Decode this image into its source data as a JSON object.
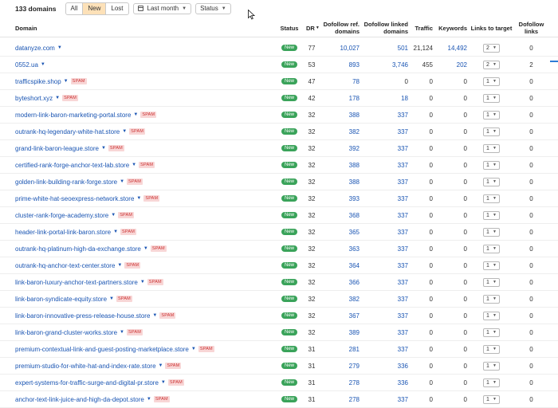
{
  "toolbar": {
    "domain_count": "133 domains",
    "filters": [
      "All",
      "New",
      "Lost"
    ],
    "active_filter": "New",
    "date_range": "Last month",
    "status": "Status"
  },
  "columns": {
    "domain": "Domain",
    "status": "Status",
    "dr": "DR",
    "dofollow_ref_domains": "Dofollow ref. domains",
    "dofollow_linked_domains": "Dofollow linked domains",
    "traffic": "Traffic",
    "keywords": "Keywords",
    "links_to_target": "Links to target",
    "dofollow_links": "Dofollow links"
  },
  "labels": {
    "status_badge": "New",
    "spam": "SPAM"
  },
  "rows": [
    {
      "domain": "datanyze.com",
      "spam": false,
      "dr": "77",
      "ref": "10,027",
      "linked": "501",
      "traffic": "21,124",
      "keywords": "14,492",
      "kw_link": true,
      "links": "2",
      "dofollow": "0"
    },
    {
      "domain": "0552.ua",
      "spam": false,
      "dr": "53",
      "ref": "893",
      "linked": "3,746",
      "traffic": "455",
      "keywords": "202",
      "kw_link": true,
      "links": "2",
      "dofollow": "2"
    },
    {
      "domain": "trafficspike.shop",
      "spam": true,
      "dr": "47",
      "ref": "78",
      "linked": "0",
      "traffic": "0",
      "keywords": "0",
      "kw_link": false,
      "links": "1",
      "dofollow": "0"
    },
    {
      "domain": "byteshort.xyz",
      "spam": true,
      "dr": "42",
      "ref": "178",
      "linked": "18",
      "traffic": "0",
      "keywords": "0",
      "kw_link": false,
      "links": "1",
      "dofollow": "0"
    },
    {
      "domain": "modern-link-baron-marketing-portal.store",
      "spam": true,
      "dr": "32",
      "ref": "388",
      "linked": "337",
      "traffic": "0",
      "keywords": "0",
      "kw_link": false,
      "links": "1",
      "dofollow": "0"
    },
    {
      "domain": "outrank-hq-legendary-white-hat.store",
      "spam": true,
      "dr": "32",
      "ref": "382",
      "linked": "337",
      "traffic": "0",
      "keywords": "0",
      "kw_link": false,
      "links": "1",
      "dofollow": "0"
    },
    {
      "domain": "grand-link-baron-league.store",
      "spam": true,
      "dr": "32",
      "ref": "392",
      "linked": "337",
      "traffic": "0",
      "keywords": "0",
      "kw_link": false,
      "links": "1",
      "dofollow": "0"
    },
    {
      "domain": "certified-rank-forge-anchor-text-lab.store",
      "spam": true,
      "dr": "32",
      "ref": "388",
      "linked": "337",
      "traffic": "0",
      "keywords": "0",
      "kw_link": false,
      "links": "1",
      "dofollow": "0"
    },
    {
      "domain": "golden-link-building-rank-forge.store",
      "spam": true,
      "dr": "32",
      "ref": "388",
      "linked": "337",
      "traffic": "0",
      "keywords": "0",
      "kw_link": false,
      "links": "1",
      "dofollow": "0"
    },
    {
      "domain": "prime-white-hat-seoexpress-network.store",
      "spam": true,
      "dr": "32",
      "ref": "393",
      "linked": "337",
      "traffic": "0",
      "keywords": "0",
      "kw_link": false,
      "links": "1",
      "dofollow": "0"
    },
    {
      "domain": "cluster-rank-forge-academy.store",
      "spam": true,
      "dr": "32",
      "ref": "368",
      "linked": "337",
      "traffic": "0",
      "keywords": "0",
      "kw_link": false,
      "links": "1",
      "dofollow": "0"
    },
    {
      "domain": "header-link-portal-link-baron.store",
      "spam": true,
      "dr": "32",
      "ref": "365",
      "linked": "337",
      "traffic": "0",
      "keywords": "0",
      "kw_link": false,
      "links": "1",
      "dofollow": "0"
    },
    {
      "domain": "outrank-hq-platinum-high-da-exchange.store",
      "spam": true,
      "dr": "32",
      "ref": "363",
      "linked": "337",
      "traffic": "0",
      "keywords": "0",
      "kw_link": false,
      "links": "1",
      "dofollow": "0"
    },
    {
      "domain": "outrank-hq-anchor-text-center.store",
      "spam": true,
      "dr": "32",
      "ref": "364",
      "linked": "337",
      "traffic": "0",
      "keywords": "0",
      "kw_link": false,
      "links": "1",
      "dofollow": "0"
    },
    {
      "domain": "link-baron-luxury-anchor-text-partners.store",
      "spam": true,
      "dr": "32",
      "ref": "366",
      "linked": "337",
      "traffic": "0",
      "keywords": "0",
      "kw_link": false,
      "links": "1",
      "dofollow": "0"
    },
    {
      "domain": "link-baron-syndicate-equity.store",
      "spam": true,
      "dr": "32",
      "ref": "382",
      "linked": "337",
      "traffic": "0",
      "keywords": "0",
      "kw_link": false,
      "links": "1",
      "dofollow": "0"
    },
    {
      "domain": "link-baron-innovative-press-release-house.store",
      "spam": true,
      "dr": "32",
      "ref": "367",
      "linked": "337",
      "traffic": "0",
      "keywords": "0",
      "kw_link": false,
      "links": "1",
      "dofollow": "0"
    },
    {
      "domain": "link-baron-grand-cluster-works.store",
      "spam": true,
      "dr": "32",
      "ref": "389",
      "linked": "337",
      "traffic": "0",
      "keywords": "0",
      "kw_link": false,
      "links": "1",
      "dofollow": "0"
    },
    {
      "domain": "premium-contextual-link-and-guest-posting-marketplace.store",
      "spam": true,
      "dr": "31",
      "ref": "281",
      "linked": "337",
      "traffic": "0",
      "keywords": "0",
      "kw_link": false,
      "links": "1",
      "dofollow": "0"
    },
    {
      "domain": "premium-studio-for-white-hat-and-index-rate.store",
      "spam": true,
      "dr": "31",
      "ref": "279",
      "linked": "336",
      "traffic": "0",
      "keywords": "0",
      "kw_link": false,
      "links": "1",
      "dofollow": "0"
    },
    {
      "domain": "expert-systems-for-traffic-surge-and-digital-pr.store",
      "spam": true,
      "dr": "31",
      "ref": "278",
      "linked": "336",
      "traffic": "0",
      "keywords": "0",
      "kw_link": false,
      "links": "1",
      "dofollow": "0"
    },
    {
      "domain": "anchor-text-link-juice-and-high-da-depot.store",
      "spam": true,
      "dr": "31",
      "ref": "278",
      "linked": "337",
      "traffic": "0",
      "keywords": "0",
      "kw_link": false,
      "links": "1",
      "dofollow": "0"
    }
  ]
}
